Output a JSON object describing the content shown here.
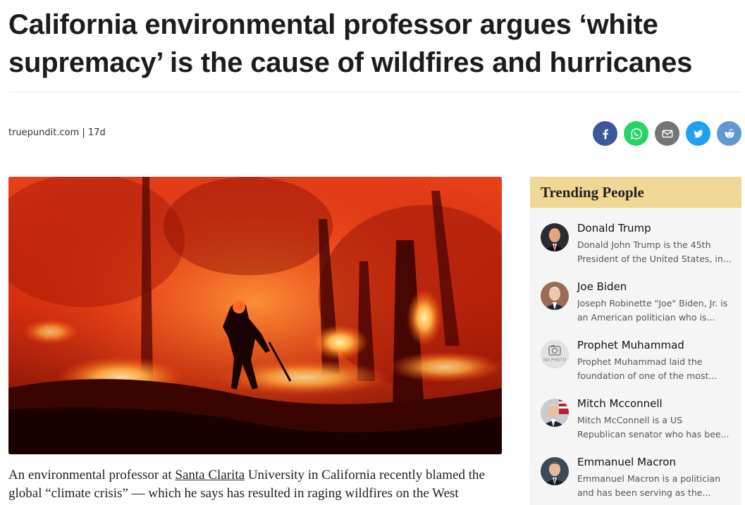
{
  "article": {
    "headline": "California environmental professor argues ‘white supremacy’ is the cause of wildfires and hurricanes",
    "byline": "truepundit.com | 17d",
    "body_before_link": "An environmental professor at ",
    "body_link": "Santa Clarita",
    "body_after_link": " University in California recently blamed the global “climate crisis” — which he says has resulted in raging wildfires on the West"
  },
  "share": [
    {
      "name": "facebook",
      "icon": "facebook-icon",
      "color": "#3b5998"
    },
    {
      "name": "whatsapp",
      "icon": "whatsapp-icon",
      "color": "#25d366"
    },
    {
      "name": "email",
      "icon": "email-icon",
      "color": "#757575"
    },
    {
      "name": "twitter",
      "icon": "twitter-icon",
      "color": "#1da1f2"
    },
    {
      "name": "reddit",
      "icon": "reddit-icon",
      "color": "#5f99cf"
    }
  ],
  "trending": {
    "title": "Trending People",
    "people": [
      {
        "name": "Donald Trump",
        "desc": "Donald John Trump is the 45th President of the United States, in..."
      },
      {
        "name": "Joe Biden",
        "desc": "Joseph Robinette \"Joe\" Biden, Jr. is an American politician who is..."
      },
      {
        "name": "Prophet Muhammad",
        "desc": "Prophet Muhammad laid the foundation of one of the most...",
        "no_photo_label": "NO PHOTO"
      },
      {
        "name": "Mitch Mcconnell",
        "desc": "Mitch McConnell is a US Republican senator who has bee..."
      },
      {
        "name": "Emmanuel Macron",
        "desc": "Emmanuel Macron is a politician and has been serving as the..."
      }
    ]
  },
  "colors": {
    "trending_header_bg": "#f0d795",
    "sidebar_bg": "#f5f5f5"
  }
}
